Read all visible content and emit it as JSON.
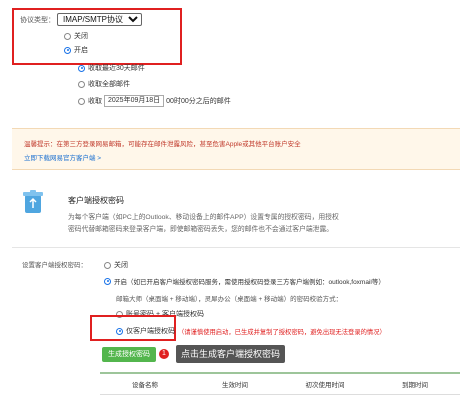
{
  "protocol": {
    "label": "协议类型：",
    "selected": "IMAP/SMTP协议",
    "off_label": "关闭",
    "on_label": "开启"
  },
  "receive": {
    "opt_recent": "收取最近30天邮件",
    "opt_all": "收取全部邮件",
    "opt_since_prefix": "收取",
    "opt_since_date": "2025年09月18日",
    "opt_since_time": "00时00分之后的邮件"
  },
  "notice": {
    "text": "温馨提示：在第三方登录网易邮箱，可能存在邮件泄露风险，甚至危害Apple或其他平台账户安全",
    "link": "立即下载网易官方客户端 >"
  },
  "client_auth": {
    "title": "客户端授权密码",
    "desc_line1": "为每个客户端（如PC上的Outlook、移动设备上的邮件APP）设置专属的授权密码，用授权",
    "desc_line2": "密码代替邮箱密码来登录客户端，即使邮箱密码丢失，您的邮件也不会通过客户端泄露。"
  },
  "settings": {
    "label": "设置客户端授权密码：",
    "off_label": "关闭",
    "on_label": "开启（如已开启客户端授权密码服务，需使用授权码登录三方客户端例如：outlook,foxmail等）",
    "sub_text": "邮箱大师（桌面端 + 移动端），灵犀办公（桌面端 + 移动端）的密码校验方式：",
    "opt_both": "账号密码 + 客户端授权码",
    "opt_only": "仅客户端授权码",
    "warning": "（请谨慎使用启动，已生成并复制了授权密码，避免出现无法登录的情况）"
  },
  "generate": {
    "button": "生成授权密码",
    "badge": "1",
    "tooltip": "点击生成客户端授权密码"
  },
  "table": {
    "headers": [
      "设备名称",
      "生效时间",
      "初次使用时间",
      "到期时间"
    ]
  },
  "colors": {
    "highlight": "#e02020",
    "accent": "#1a73e8",
    "button": "#53b64d"
  }
}
